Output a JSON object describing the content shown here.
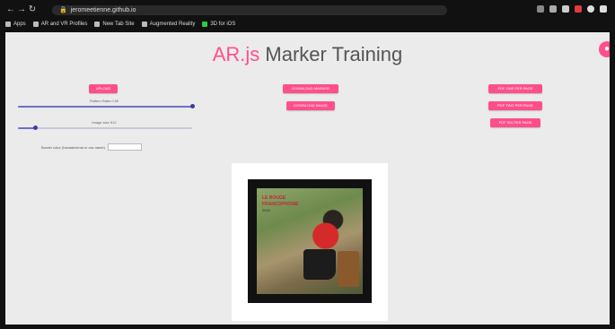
{
  "browser": {
    "url": "jeromeetienne.github.io",
    "bookmarks": [
      "Apps",
      "AR and VR Profiles",
      "New Tab Site",
      "Augmented Reality",
      "3D for iOS"
    ]
  },
  "page": {
    "title_pink": "AR.js",
    "title_rest": " Marker Training",
    "github_icon": "github-icon",
    "upload_button": "UPLOAD",
    "pattern_ratio_label": "Pattern Ratio 0.50",
    "image_size_label": "Image size 512",
    "pattern_ratio_value": 0.5,
    "image_size_value": 0.1,
    "color_label": "Border color (hexadecimal or css name)",
    "download_marker_button": "DOWNLOAD MARKER",
    "download_image_button": "DOWNLOAD IMAGE",
    "pdf_one_button": "PDF ONE PER PAGE",
    "pdf_two_button": "PDF TWO PER PAGE",
    "pdf_six_button": "PDF SIX PER PAGE",
    "photo_title_line1": "LE ROUGE",
    "photo_title_line2": "FRANCOPHONIE",
    "photo_subtitle": "2019",
    "accent_color": "#ff4f8b"
  }
}
